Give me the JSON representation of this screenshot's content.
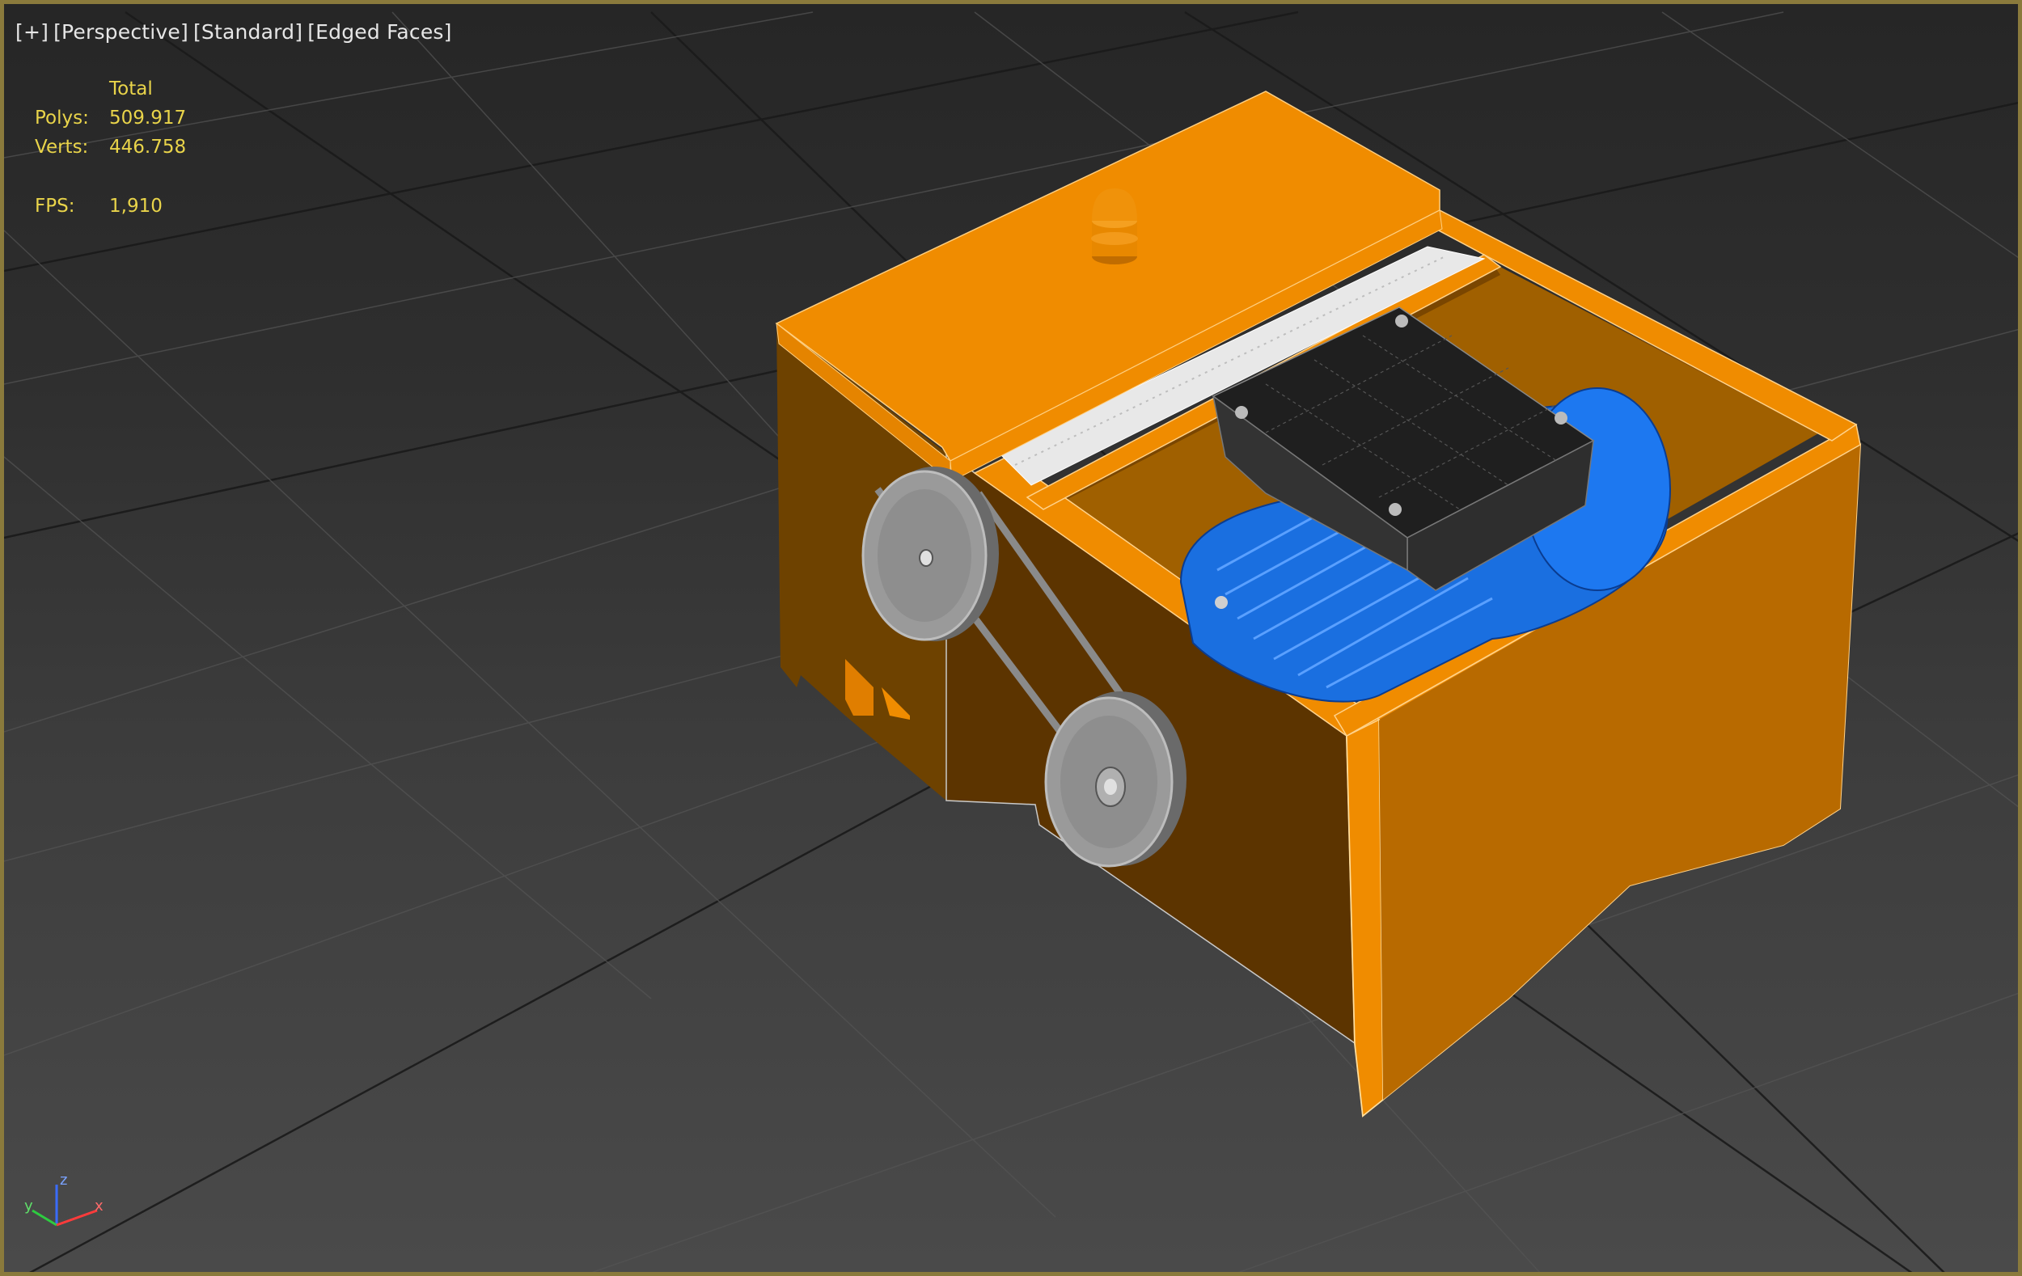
{
  "viewport": {
    "labels": [
      "[+]",
      "[Perspective]",
      "[Standard]",
      "[Edged Faces]"
    ]
  },
  "stats": {
    "header": "Total",
    "polys_label": "Polys:",
    "polys_value": "509.917",
    "verts_label": "Verts:",
    "verts_value": "446.758",
    "fps_label": "FPS:",
    "fps_value": "1,910"
  },
  "axis": {
    "x": "x",
    "y": "y",
    "z": "z"
  },
  "colors": {
    "frame": "#8a7a3c",
    "stats_text": "#e9d44a",
    "box_orange": "#f08c00",
    "box_dark": "#5c3400",
    "motor_blue": "#1a6fe0",
    "terminal_box": "#2a2a2a",
    "pulley_gray": "#8e8e8e"
  }
}
